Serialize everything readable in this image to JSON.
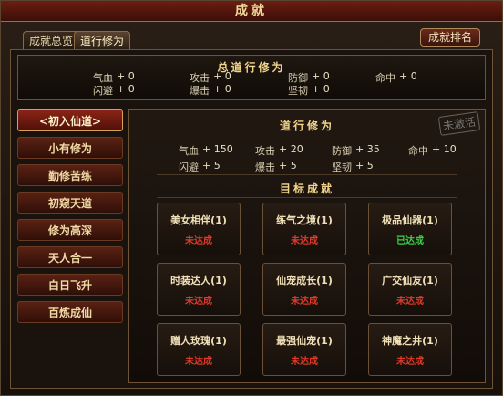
{
  "window": {
    "title": "成就"
  },
  "tabs": [
    {
      "label": "成就总览",
      "active": false
    },
    {
      "label": "道行修为",
      "active": true
    }
  ],
  "rank_button": "成就排名",
  "summary": {
    "title": "总道行修为",
    "row1": [
      {
        "label": "气血",
        "value": "+ 0"
      },
      {
        "label": "攻击",
        "value": "+ 0"
      },
      {
        "label": "防御",
        "value": "+ 0"
      },
      {
        "label": "命中",
        "value": "+ 0"
      }
    ],
    "row2": [
      {
        "label": "闪避",
        "value": "+ 0"
      },
      {
        "label": "爆击",
        "value": "+ 0"
      },
      {
        "label": "坚韧",
        "value": "+ 0"
      }
    ]
  },
  "sidebar": [
    {
      "label": "<初入仙道>",
      "active": true
    },
    {
      "label": "小有修为",
      "active": false
    },
    {
      "label": "勤修苦练",
      "active": false
    },
    {
      "label": "初窥天道",
      "active": false
    },
    {
      "label": "修为高深",
      "active": false
    },
    {
      "label": "天人合一",
      "active": false
    },
    {
      "label": "白日飞升",
      "active": false
    },
    {
      "label": "百炼成仙",
      "active": false
    }
  ],
  "main": {
    "seal_text": "未激活",
    "title": "道行修为",
    "row1": [
      {
        "label": "气血",
        "value": "+ 150"
      },
      {
        "label": "攻击",
        "value": "+ 20"
      },
      {
        "label": "防御",
        "value": "+ 35"
      },
      {
        "label": "命中",
        "value": "+ 10"
      }
    ],
    "row2": [
      {
        "label": "闪避",
        "value": "+ 5"
      },
      {
        "label": "爆击",
        "value": "+ 5"
      },
      {
        "label": "坚韧",
        "value": "+ 5"
      }
    ],
    "goals_title": "目标成就",
    "goals": [
      {
        "name": "美女相伴(1)",
        "status": "未达成",
        "done": false
      },
      {
        "name": "练气之境(1)",
        "status": "未达成",
        "done": false
      },
      {
        "name": "极品仙器(1)",
        "status": "已达成",
        "done": true
      },
      {
        "name": "时装达人(1)",
        "status": "未达成",
        "done": false
      },
      {
        "name": "仙宠成长(1)",
        "status": "未达成",
        "done": false
      },
      {
        "name": "广交仙友(1)",
        "status": "未达成",
        "done": false
      },
      {
        "name": "赠人玫瑰(1)",
        "status": "未达成",
        "done": false
      },
      {
        "name": "最强仙宠(1)",
        "status": "未达成",
        "done": false
      },
      {
        "name": "神魔之井(1)",
        "status": "未达成",
        "done": false
      }
    ]
  }
}
